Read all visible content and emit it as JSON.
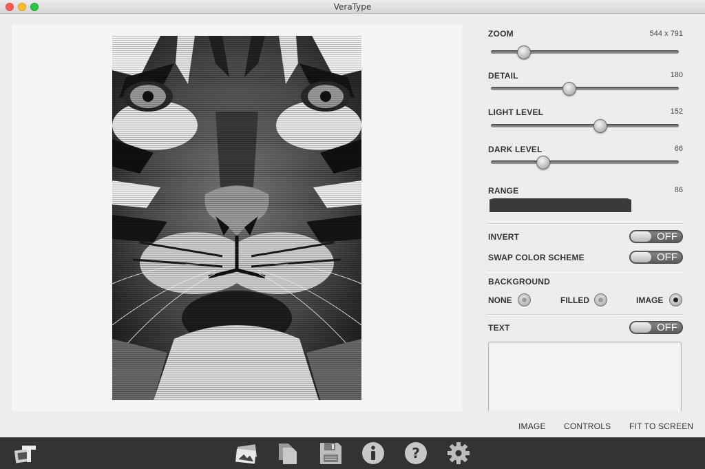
{
  "window": {
    "title": "VeraType"
  },
  "preview": {
    "alt": "tiger face rendered as typographic art"
  },
  "controls": {
    "zoom": {
      "label": "ZOOM",
      "value": "544 x 791",
      "level": 0.15
    },
    "detail": {
      "label": "DETAIL",
      "value": "180",
      "level": 0.41
    },
    "light_level": {
      "label": "LIGHT LEVEL",
      "value": "152",
      "level": 0.59
    },
    "dark_level": {
      "label": "DARK LEVEL",
      "value": "66",
      "level": 0.26
    },
    "range": {
      "label": "RANGE",
      "value": "86"
    },
    "invert": {
      "label": "INVERT",
      "state": "OFF"
    },
    "swap": {
      "label": "SWAP COLOR SCHEME",
      "state": "OFF"
    },
    "background": {
      "label": "BACKGROUND",
      "options": [
        {
          "label": "NONE",
          "checked": false
        },
        {
          "label": "FILLED",
          "checked": false
        },
        {
          "label": "IMAGE",
          "checked": true
        }
      ]
    },
    "text": {
      "label": "TEXT",
      "state": "OFF",
      "value": ""
    }
  },
  "view_links": {
    "image": "IMAGE",
    "controls": "CONTROLS",
    "fit": "FIT TO SCREEN"
  },
  "toolbar": {
    "items": [
      "app-logo-icon",
      "images-icon",
      "documents-icon",
      "save-icon",
      "info-icon",
      "help-icon",
      "settings-icon"
    ]
  }
}
